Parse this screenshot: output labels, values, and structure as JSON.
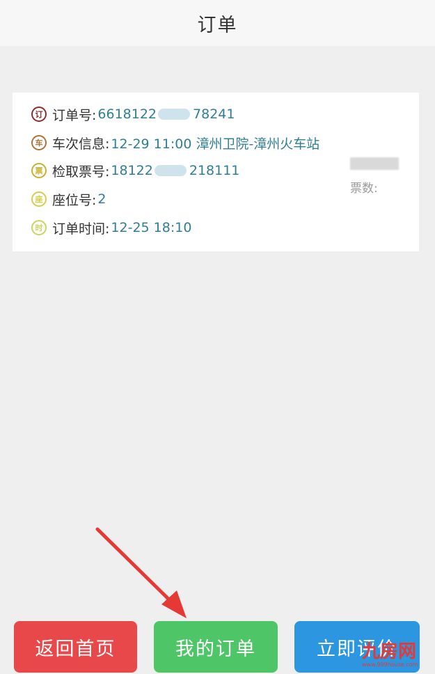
{
  "header": {
    "title": "订单"
  },
  "order": {
    "rows": [
      {
        "icon": "订",
        "icon_name": "order-number-icon",
        "icon_color": "#8e2c2c",
        "label": "订单号:",
        "val_a": "6618122",
        "val_b": "78241"
      },
      {
        "icon": "车",
        "icon_name": "train-info-icon",
        "icon_color": "#a8743a",
        "label": "车次信息:",
        "val_a": "12-29 11:00 漳州卫院-漳州火车站",
        "val_b": ""
      },
      {
        "icon": "票",
        "icon_name": "ticket-code-icon",
        "icon_color": "#c7b22a",
        "label": "检取票号:",
        "val_a": "18122",
        "val_b": "218111"
      },
      {
        "icon": "座",
        "icon_name": "seat-icon",
        "icon_color": "#d3cf4a",
        "label": "座位号:",
        "val_a": "2",
        "val_b": ""
      },
      {
        "icon": "时",
        "icon_name": "order-time-icon",
        "icon_color": "#c8d65b",
        "label": "订单时间:",
        "val_a": "12-25 18:10",
        "val_b": ""
      }
    ],
    "side_text": "票数:"
  },
  "buttons": {
    "home": "返回首页",
    "my_orders": "我的订单",
    "evaluate": "立即评价"
  },
  "watermark": {
    "big": "九房网",
    "small": "www.999house.com"
  },
  "colors": {
    "home_btn": "#e9484b",
    "orders_btn": "#4ec667",
    "evaluate_btn": "#2c96e0",
    "annotation_arrow": "#e53935"
  }
}
